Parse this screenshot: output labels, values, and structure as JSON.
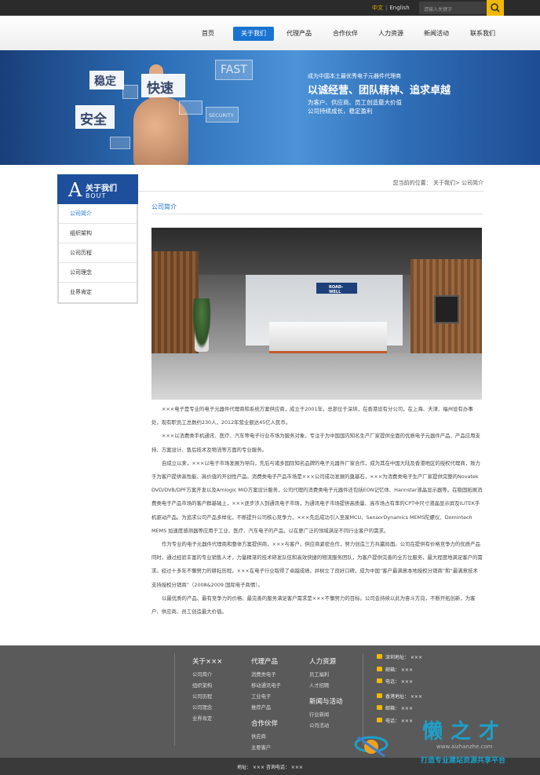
{
  "topbar": {
    "lang_zh": "中文",
    "lang_sep": "|",
    "lang_en": "English",
    "search_placeholder": "请输入关键字"
  },
  "nav": {
    "items": [
      "首页",
      "关于我们",
      "代理产品",
      "合作伙伴",
      "人力资源",
      "新闻活动",
      "联系我们"
    ],
    "active": "关于我们"
  },
  "banner": {
    "tiles": [
      "稳定",
      "快速",
      "FAST",
      "安全",
      "SECURITY"
    ],
    "sub": "成为中国本土最优秀电子元器件代理商",
    "main": "以诚经营、团队精神、追求卓越",
    "line1": "为客户、供应商、员工创造最大价值",
    "line2": "公司持续成长，稳定盈利"
  },
  "sidebar": {
    "head_letter": "A",
    "head_cn": "关于我们",
    "head_en": "BOUT",
    "items": [
      "公司简介",
      "组织架构",
      "公司历程",
      "公司理念",
      "业界肯定"
    ],
    "active": "公司简介"
  },
  "breadcrumb": "您当前的位置： 关于我们> 公司简介",
  "section_title": "公司简介",
  "photo": {
    "sign_text": "ROAD-WELL"
  },
  "content": {
    "paragraphs": [
      "×××电子是专业的电子元器件代理商和系统方案供应商，成立于2001年，总部位于深圳，在香港设有分公司，在上海、天津、福州设有办事处，现有职员工总数约230人，2012年营业额达45亿人民币。",
      "×××以消费类手机通讯、医疗、汽车等电子行业市场为服务对象，专注于为中国国内知名生产厂家提供全面的优质电子元器件产品、产品应用支持、方案设计、售后技术及物流等方面的专业服务。",
      "自成立以来，×××以电子市场发展为导向，先后与诸多国际知名品牌的电子元器件厂家合作，成为其在中国大陆及香港地区的授权代理商，致力于为客户提供高性能、高价值的开创性产品。消费类电子产品市场是×××公司成功发展的奠基石，×××为消费类电子生产厂家提供完整的Novatek DVD/DVB/DPF方案开发以及Amlogic MID方案设计服务，公司代理的消费类电子元器件还包括EON记忆体、Hannstar液晶显示器等。在稳固拓展消费类电子产品市场的客户群基础上，×××逐步涉入到通讯电子市场，为通讯电子市场提供高质量、高市场占有率的CPT中尺寸液晶显示屏及ILITEK手机驱动产品。为追求公司产品多样化，不断提升公司核心竞争力，×××先后成功引入至泉MCU、SensorDynamics MEMS陀螺仪、Domintech MEMS 加速度感测器等应用于工业、医疗、汽车电子的产品，以在更广泛的领域满足不同行业客户的需求。",
      "作为专业的电子元器件代理商和整体方案提供商，×××与客户、供应商紧密合作，努力创造三方共赢局面。公司在提供有价格竞争力的优质产品同时，通过经验丰富的专业销售人才，力量精湛的技术研发队伍和高效快捷的物流服务团队，为客户提供完善的全方位服务，最大程度地满足客户的需求。经过十多年不懈努力的耕耘历程，×××在电子行业取得了卓越成绩，并树立了良好口碑，成为中国“客户最满意本地授权分销商”和“最满意技术支持授权分销商”（2008&2009 国际电子商情）。",
      "以最优质的产品、最有竞争力的价格、最完善的服务满足客户需求是×××不懈努力的目标。公司会持续以此为奋斗方向，不断开拓创新，为客户、供应商、员工创造最大价值。"
    ]
  },
  "footer": {
    "col1": {
      "head": "关于×××",
      "links": [
        "公司简介",
        "组织架构",
        "公司历程",
        "公司理念",
        "业界肯定"
      ]
    },
    "col2": {
      "head": "代理产品",
      "links": [
        "消费类电子",
        "移动通讯电子",
        "工业电子",
        "推荐产品"
      ]
    },
    "col2b": {
      "head": "合作伙伴",
      "links": [
        "供应商",
        "主要客户"
      ]
    },
    "col3": {
      "head": "人力资源",
      "links": [
        "员工福利",
        "人才招聘"
      ]
    },
    "col3b": {
      "head": "新闻与活动",
      "links": [
        "行业新闻",
        "公司活动"
      ]
    },
    "contact": [
      "深圳地址： ×××",
      "邮箱： ×××",
      "电话： ×××",
      "香港地址： ×××",
      "邮箱： ×××",
      "电话： ×××"
    ],
    "bottom": "地址： ×××  咨询电话： ×××"
  },
  "watermark": {
    "title": "懒之才",
    "url": "www.aizhanzhe.com",
    "slogan": "打造专业建站资源共享平台"
  },
  "colors": {
    "accent": "#1a73d1",
    "gold": "#f0b800",
    "footer": "#5a5a5a"
  }
}
